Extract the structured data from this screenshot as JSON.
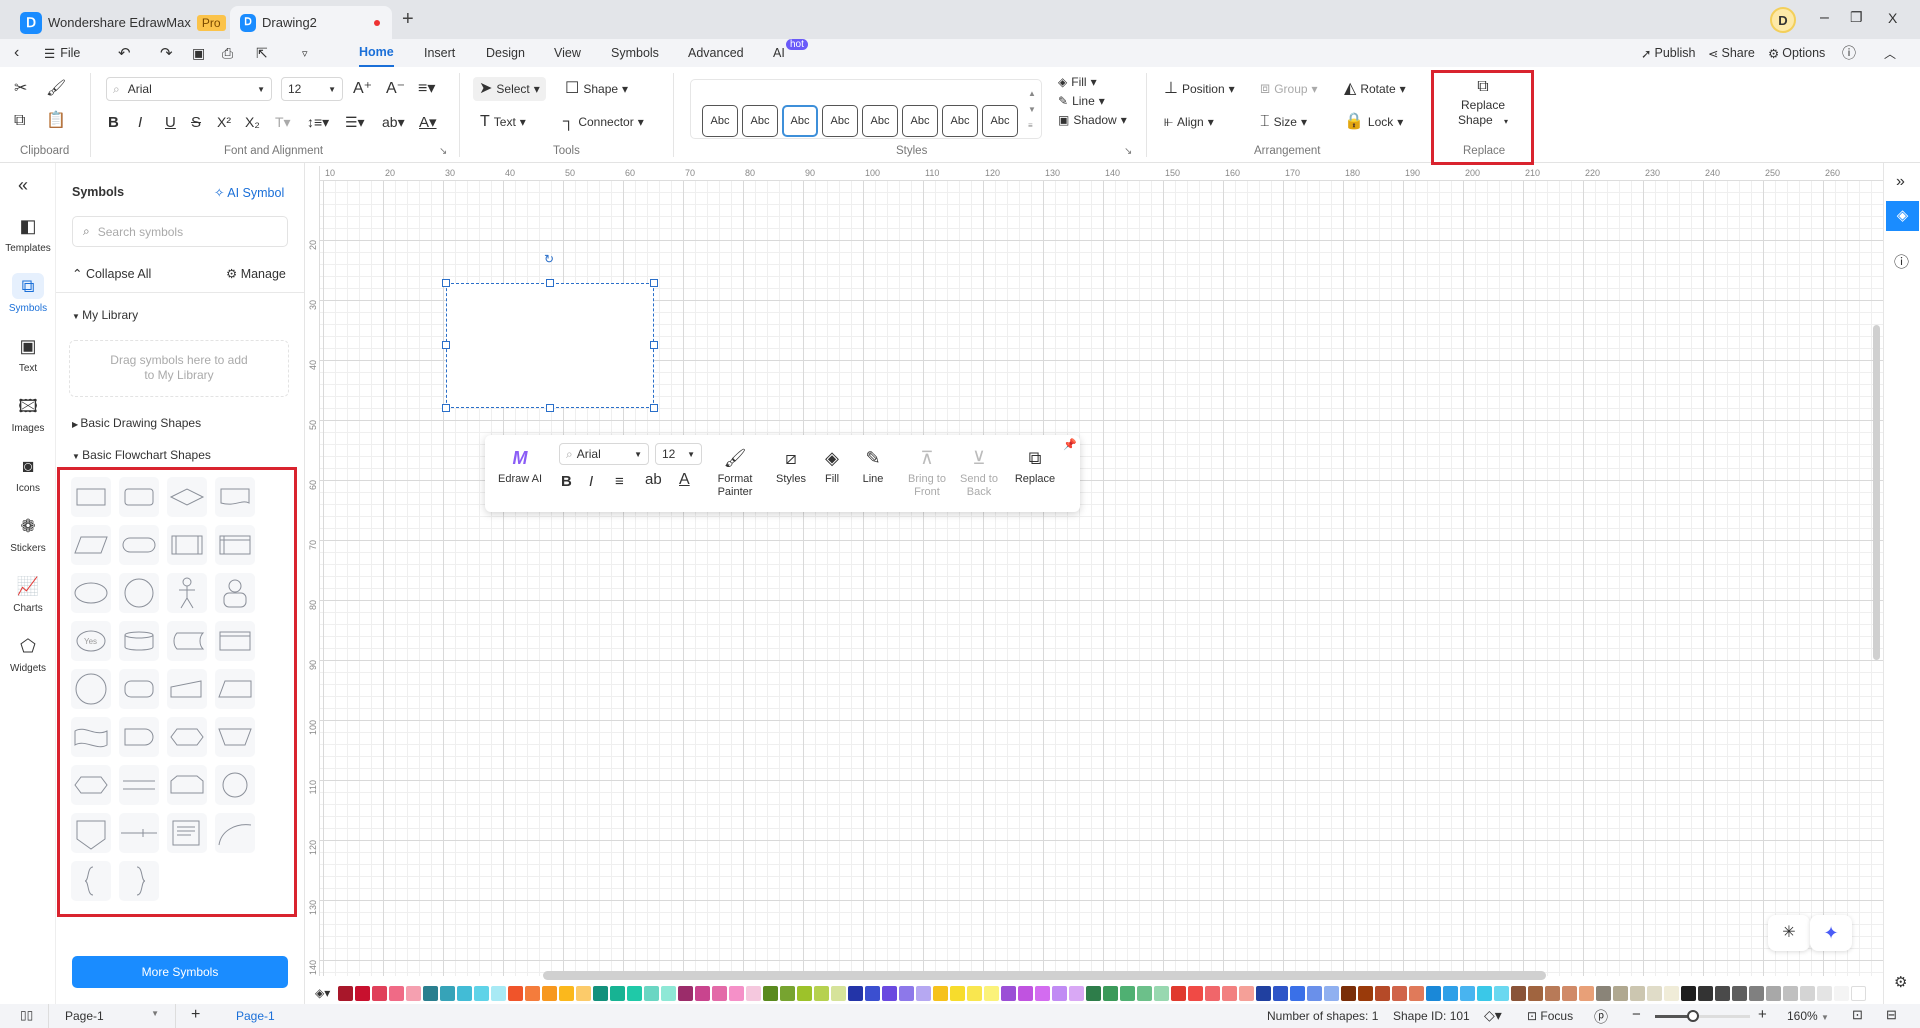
{
  "titlebar": {
    "app_tab": "Wondershare EdrawMax",
    "pro_badge": "Pro",
    "doc_tab": "Drawing2",
    "new_tab": "+",
    "avatar": "D",
    "minimize": "–",
    "restore": "❐",
    "close": "X"
  },
  "menu": {
    "file": "File",
    "tabs": [
      "Home",
      "Insert",
      "Design",
      "View",
      "Symbols",
      "Advanced",
      "AI"
    ],
    "active_tab": "Home",
    "hot_badge": "hot",
    "publish": "Publish",
    "share": "Share",
    "options": "Options"
  },
  "ribbon": {
    "clipboard_label": "Clipboard",
    "font": {
      "family": "Arial",
      "size": "12",
      "group_label": "Font and Alignment"
    },
    "tools": {
      "select": "Select",
      "shape": "Shape",
      "text": "Text",
      "connector": "Connector",
      "group_label": "Tools"
    },
    "styles": {
      "swatches": [
        "Abc",
        "Abc",
        "Abc",
        "Abc",
        "Abc",
        "Abc",
        "Abc",
        "Abc"
      ],
      "selected_index": 2,
      "fill": "Fill",
      "line": "Line",
      "shadow": "Shadow",
      "group_label": "Styles"
    },
    "arrangement": {
      "position": "Position",
      "group": "Group",
      "rotate": "Rotate",
      "align": "Align",
      "size": "Size",
      "lock": "Lock",
      "group_label": "Arrangement"
    },
    "replace": {
      "button_line1": "Replace",
      "button_line2": "Shape",
      "group_label": "Replace"
    }
  },
  "rail": {
    "items": [
      {
        "label": "Templates",
        "icon": "templates-icon"
      },
      {
        "label": "Symbols",
        "icon": "symbols-icon",
        "active": true
      },
      {
        "label": "Text",
        "icon": "text-icon"
      },
      {
        "label": "Images",
        "icon": "images-icon"
      },
      {
        "label": "Icons",
        "icon": "icons-icon"
      },
      {
        "label": "Stickers",
        "icon": "stickers-icon"
      },
      {
        "label": "Charts",
        "icon": "charts-icon"
      },
      {
        "label": "Widgets",
        "icon": "widgets-icon"
      }
    ]
  },
  "panel": {
    "title": "Symbols",
    "ai_symbol": "AI Symbol",
    "search_placeholder": "Search symbols",
    "collapse_all": "Collapse All",
    "manage": "Manage",
    "my_library": "My Library",
    "drop_hint_1": "Drag symbols here to add",
    "drop_hint_2": "to My Library",
    "basic_drawing": "Basic Drawing Shapes",
    "basic_flowchart": "Basic Flowchart Shapes",
    "shapes": [
      "process",
      "rounded-rect",
      "decision",
      "document",
      "data",
      "terminator",
      "predefined-process",
      "internal-storage",
      "ellipse",
      "circle",
      "actor",
      "user",
      "yes-bubble",
      "database",
      "stored-data",
      "card-list",
      "connector-circle",
      "direct-data",
      "display",
      "manual-operation",
      "tape",
      "delay",
      "display-alt",
      "manual-input",
      "preparation",
      "divider",
      "loop-limit",
      "circle-alt",
      "off-page",
      "arrow-line",
      "annotation",
      "arc",
      "brace-left",
      "brace-right"
    ],
    "more_symbols": "More Symbols"
  },
  "ruler": {
    "top": [
      "10",
      "20",
      "30",
      "40",
      "50",
      "60",
      "70",
      "80",
      "90",
      "100",
      "110",
      "120",
      "130",
      "140",
      "150",
      "160",
      "170",
      "180",
      "190",
      "200",
      "210",
      "220",
      "230",
      "240",
      "250",
      "260"
    ],
    "left": [
      "20",
      "30",
      "40",
      "50",
      "60",
      "70",
      "80",
      "90",
      "100",
      "110",
      "120",
      "130",
      "140"
    ]
  },
  "floating_toolbar": {
    "edraw_ai": "Edraw AI",
    "font": "Arial",
    "size": "12",
    "format_painter_1": "Format",
    "format_painter_2": "Painter",
    "styles": "Styles",
    "fill": "Fill",
    "line": "Line",
    "bring_front_1": "Bring to",
    "bring_front_2": "Front",
    "send_back_1": "Send to",
    "send_back_2": "Back",
    "replace": "Replace"
  },
  "palette": [
    "#a8172a",
    "#c8102e",
    "#e0405a",
    "#f06a86",
    "#f5a0b0",
    "#2a7f8f",
    "#36a3b8",
    "#42bcd6",
    "#5fd3e8",
    "#a8eaf5",
    "#f0542a",
    "#f47c3c",
    "#f7981f",
    "#fbb81c",
    "#fccb6a",
    "#13917c",
    "#17b393",
    "#1fc9a8",
    "#6ad6c3",
    "#8ee8d6",
    "#9b2c6a",
    "#c9448e",
    "#e36aa8",
    "#f590c8",
    "#f5c8de",
    "#5a8a1e",
    "#77a430",
    "#9dc22a",
    "#b6d14f",
    "#d6e39a",
    "#2334a8",
    "#3b4fd0",
    "#6a49e0",
    "#8d78ea",
    "#b6a8f2",
    "#f6c21c",
    "#f7dc2c",
    "#f9e64f",
    "#fbf27a",
    "#9b4fd6",
    "#c053e0",
    "#d36cf0",
    "#c18bf4",
    "#d9a8f5",
    "#2e7d4a",
    "#3b9a5a",
    "#4fb072",
    "#6cc08a",
    "#98d8b0",
    "#e03a2e",
    "#f04a45",
    "#f0666a",
    "#f28080",
    "#f5a098",
    "#2040a0",
    "#2e55c8",
    "#3a70e8",
    "#6a90ea",
    "#90b0f0",
    "#7a2e08",
    "#9a3a0a",
    "#b54a28",
    "#d0644a",
    "#e07a5a",
    "#1a88d8",
    "#2ea0e8",
    "#48b4f0",
    "#3ac8e8",
    "#6ad8f0",
    "#8a5438",
    "#a0643f",
    "#b87a58",
    "#d08a68",
    "#e8a078",
    "#8a8478",
    "#b0a890",
    "#ccc6b0",
    "#e0dcc8",
    "#f0ecd8",
    "#1e1e1e",
    "#333333",
    "#4a4a4a",
    "#5f5f5f",
    "#808080",
    "#a8a8a8",
    "#c0c0c0",
    "#d4d4d4",
    "#e4e4e4",
    "#f4f4f4",
    "#ffffff"
  ],
  "status": {
    "page_select": "Page-1",
    "page_tab": "Page-1",
    "add_page": "+",
    "shape_count": "Number of shapes: 1",
    "shape_id": "Shape ID: 101",
    "focus": "Focus",
    "zoom": "160%",
    "zoom_fraction": 0.4
  },
  "colors": {
    "accent": "#1a6fd8",
    "highlight": "#d9232e",
    "button": "#1a8cff"
  }
}
